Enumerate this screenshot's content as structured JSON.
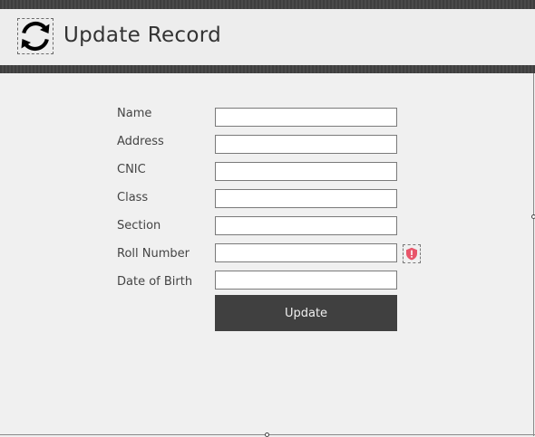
{
  "header": {
    "title": "Update Record",
    "icon": "refresh-icon"
  },
  "form": {
    "fields": [
      {
        "label": "Name",
        "value": ""
      },
      {
        "label": "Address",
        "value": ""
      },
      {
        "label": "CNIC",
        "value": ""
      },
      {
        "label": "Class",
        "value": ""
      },
      {
        "label": "Section",
        "value": ""
      },
      {
        "label": "Roll Number",
        "value": "",
        "error_icon": "error-shield-icon"
      },
      {
        "label": "Date of Birth",
        "value": ""
      }
    ],
    "submit_label": "Update"
  },
  "colors": {
    "stripe": "#404040",
    "background": "#f0f0f0",
    "button": "#404040",
    "button_text": "#f0f0f0",
    "error": "#e8556a"
  }
}
